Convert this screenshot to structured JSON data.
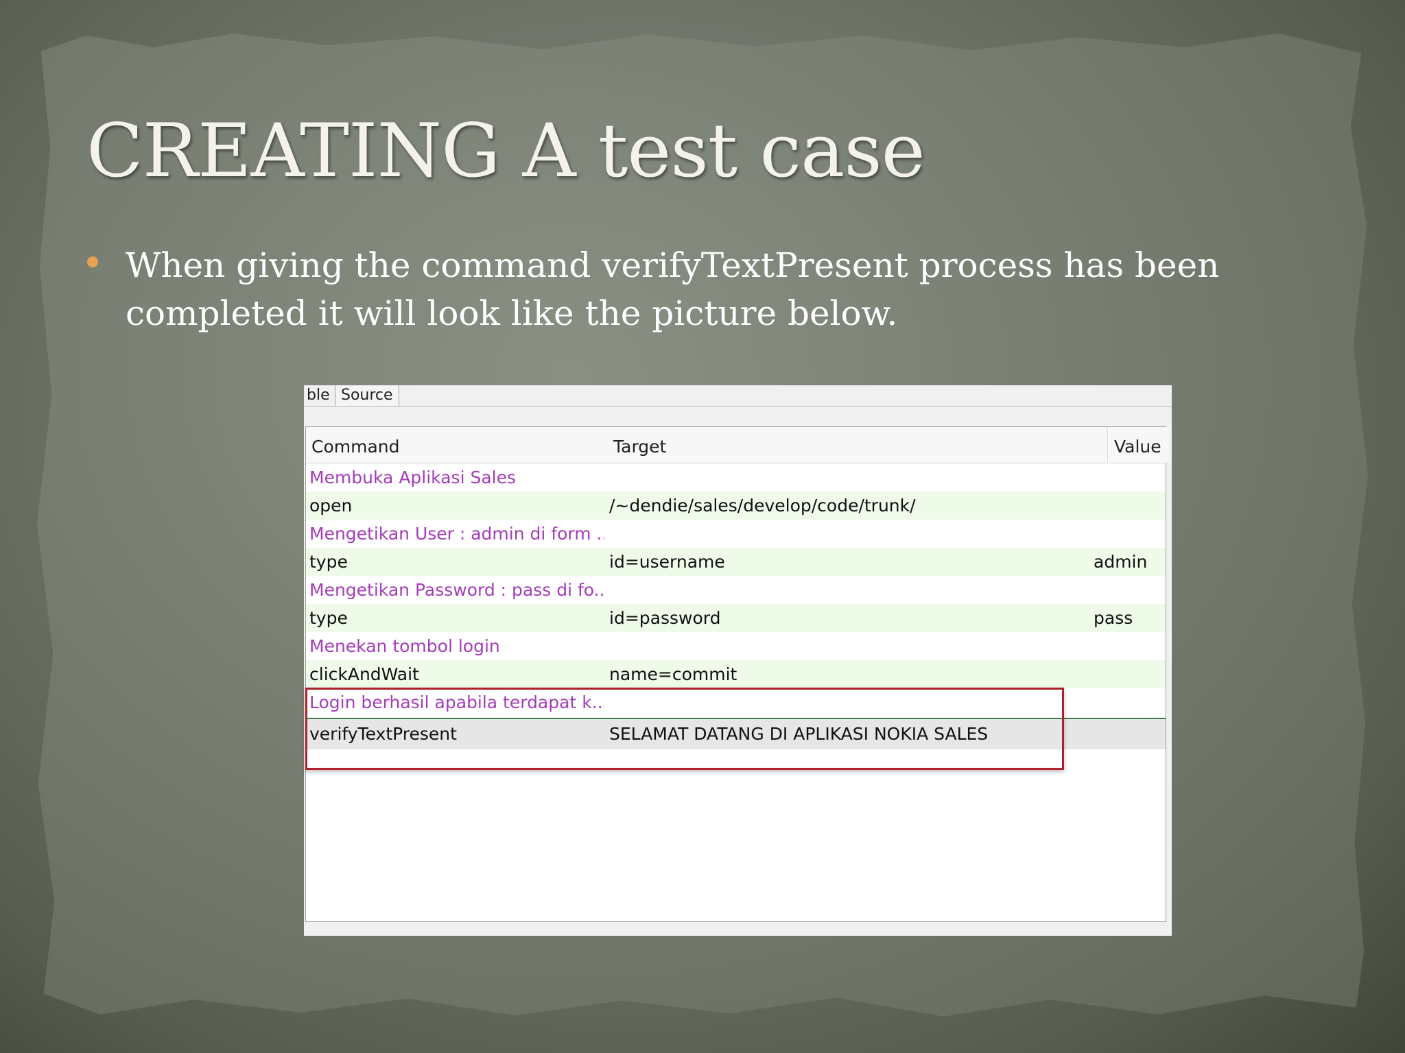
{
  "slide": {
    "title": "CREATING A test case",
    "bullet": "When giving the command verifyTextPresent process has been completed it will look like the picture below."
  },
  "editor": {
    "tabs": [
      {
        "label": "ble"
      },
      {
        "label": "Source"
      }
    ],
    "columns": {
      "command": "Command",
      "target": "Target",
      "value": "Value"
    },
    "rows": [
      {
        "kind": "comment",
        "command": "Membuka Aplikasi Sales",
        "target": "",
        "value": ""
      },
      {
        "kind": "command",
        "command": "open",
        "target": "/~dendie/sales/develop/code/trunk/",
        "value": ""
      },
      {
        "kind": "comment",
        "command": "Mengetikan User : admin di form ...",
        "target": "",
        "value": ""
      },
      {
        "kind": "command",
        "command": "type",
        "target": "id=username",
        "value": "admin"
      },
      {
        "kind": "comment",
        "command": "Mengetikan Password : pass di fo...",
        "target": "",
        "value": ""
      },
      {
        "kind": "command",
        "command": "type",
        "target": "id=password",
        "value": "pass"
      },
      {
        "kind": "comment",
        "command": "Menekan tombol login",
        "target": "",
        "value": ""
      },
      {
        "kind": "command",
        "command": "clickAndWait",
        "target": "name=commit",
        "value": ""
      },
      {
        "kind": "comment",
        "command": "Login berhasil apabila terdapat k...",
        "target": "",
        "value": ""
      },
      {
        "kind": "command",
        "command": "verifyTextPresent",
        "target": "SELAMAT DATANG DI APLIKASI NOKIA SALES",
        "value": ""
      }
    ],
    "colors": {
      "comment_text": "#a43cb9",
      "command_row_bg": "#eefbe9",
      "selected_row_bg": "#e6e6e6",
      "highlight_box": "#b0202a",
      "bullet": "#e8a150"
    }
  }
}
